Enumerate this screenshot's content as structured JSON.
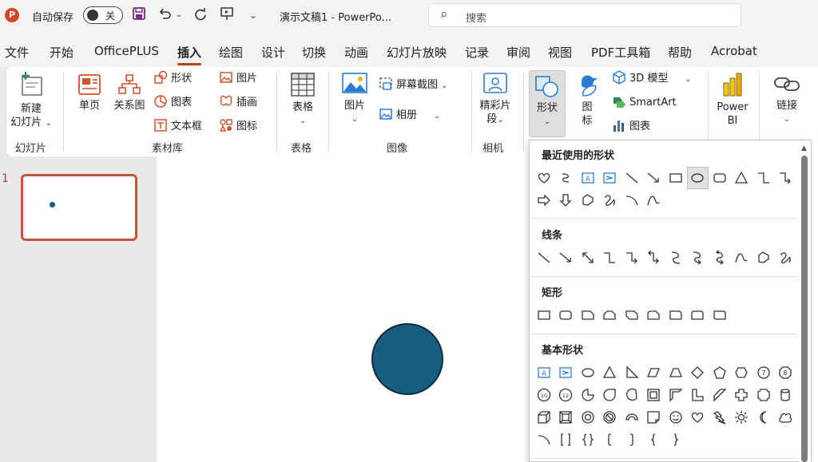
{
  "titlebar": {
    "autosave_label": "自动保存",
    "autosave_state": "关",
    "document_title": "演示文稿1  -  PowerPo...",
    "search_placeholder": "搜索"
  },
  "menu_tabs": [
    "文件",
    "开始",
    "OfficePLUS",
    "插入",
    "绘图",
    "设计",
    "切换",
    "动画",
    "幻灯片放映",
    "记录",
    "审阅",
    "视图",
    "PDF工具箱",
    "帮助",
    "Acrobat"
  ],
  "active_tab": "插入",
  "ribbon": {
    "new_slide_line1": "新建",
    "new_slide_line2": "幻灯片",
    "group_slides": "幻灯片",
    "single_page": "单页",
    "relation_chart": "关系图",
    "shape_small": "形状",
    "chart_small": "图表",
    "textbox_small": "文本框",
    "picture_small": "图片",
    "illustration_small": "插画",
    "icon_small": "图标",
    "group_materials": "素材库",
    "table": "表格",
    "group_table": "表格",
    "picture": "图片",
    "screenshot": "屏幕截图",
    "album": "相册",
    "group_image": "图像",
    "highlight_line1": "精彩片",
    "highlight_line2": "段",
    "group_camera": "相机",
    "shapes": "形状",
    "icons_line1": "图",
    "icons_line2": "标",
    "model3d": "3D 模型",
    "smartart": "SmartArt",
    "chart": "图表",
    "powerbi_line1": "Power",
    "powerbi_line2": "BI",
    "link": "链接"
  },
  "slides_pane": {
    "slide_number": "1"
  },
  "shapes_dropdown": {
    "recent_title": "最近使用的形状",
    "lines_title": "线条",
    "rect_title": "矩形",
    "basic_title": "基本形状",
    "recent_row1": [
      "heart",
      "curve-arrow",
      "textbox",
      "vertical-textbox",
      "line",
      "arrow-line",
      "rectangle",
      "oval",
      "rounded-rectangle",
      "triangle",
      "elbow-connector",
      "elbow-arrow-connector"
    ],
    "recent_row2": [
      "right-arrow",
      "down-arrow",
      "freeform",
      "scribble",
      "arc",
      "curve"
    ],
    "lines_row": [
      "line",
      "arrow-line",
      "double-arrow-line",
      "elbow-connector",
      "elbow-arrow-connector",
      "elbow-double-arrow-connector",
      "curved-connector",
      "curved-arrow-connector",
      "curved-double-arrow-connector",
      "curve",
      "freeform",
      "scribble"
    ],
    "rect_row": [
      "rectangle",
      "rounded-rectangle",
      "snip-single-corner",
      "snip-same-side",
      "snip-diagonal",
      "snip-round-single",
      "round-single-corner",
      "round-same-side",
      "round-diagonal"
    ],
    "basic_row1": [
      "textbox",
      "vertical-textbox",
      "oval",
      "triangle",
      "right-triangle",
      "parallelogram",
      "trapezoid",
      "diamond",
      "pentagon",
      "hexagon",
      "heptagon",
      "octagon"
    ],
    "basic_row2": [
      "decagon",
      "dodecagon",
      "pie",
      "teardrop",
      "chord",
      "frame",
      "half-frame",
      "l-shape",
      "diagonal-stripe",
      "plus",
      "plaque",
      "can"
    ],
    "basic_row3": [
      "cube",
      "bevel",
      "donut",
      "no-symbol",
      "block-arc",
      "folded-corner",
      "smiley",
      "heart",
      "lightning",
      "sun",
      "moon",
      "cloud"
    ],
    "basic_row4": [
      "arc",
      "double-bracket",
      "double-brace",
      "left-bracket",
      "right-bracket",
      "left-brace",
      "right-brace"
    ],
    "selected_shape": "oval"
  },
  "canvas": {
    "shape_fill": "#155e82",
    "shape_outline": "#0f2a3a"
  },
  "colors": {
    "accent": "#c43e1c",
    "icon_blue": "#2b7cd3",
    "icon_orange": "#d35230"
  }
}
